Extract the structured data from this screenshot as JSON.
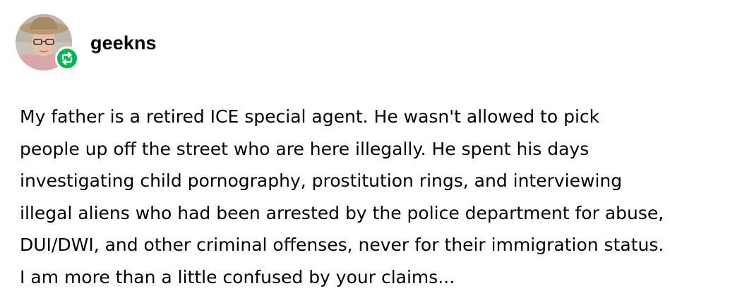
{
  "post": {
    "author": {
      "username": "geekns",
      "avatar_icon": "user-avatar",
      "badge_icon": "reblog-icon",
      "badge_color": "#00b852"
    },
    "body_lines": [
      "My father is a retired ICE special agent.  He wasn't allowed to pick",
      "people up off the street who are here illegally.  He spent his days",
      "investigating child pornography, prostitution rings, and interviewing",
      "illegal aliens who had been arrested by the police department for abuse,",
      "DUI/DWI, and other criminal offenses, never for their immigration status.",
      "I am more than a little confused by your claims..."
    ]
  }
}
